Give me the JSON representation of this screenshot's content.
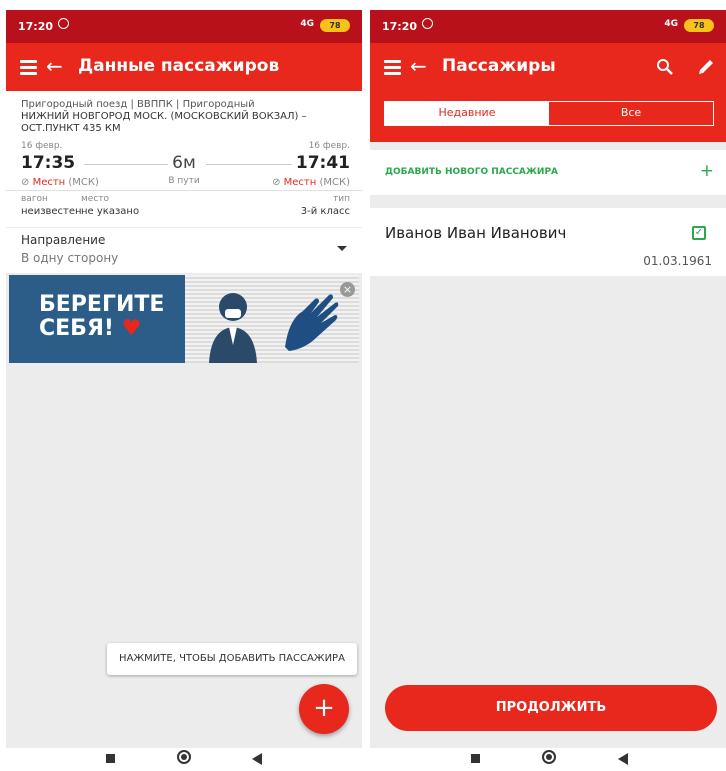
{
  "status_bar": {
    "time": "17:20",
    "network": "4G",
    "battery": "78"
  },
  "left": {
    "title": "Данные пассажиров",
    "train": {
      "type_line": "Пригородный поезд | ВВППК | Пригородный",
      "route_line1": "НИЖНИЙ НОВГОРОД МОСК. (МОСКОВСКИЙ ВОКЗАЛ) –",
      "route_line2": "ОСТ.ПУНКТ 435 КМ",
      "dep_date": "16 февр.",
      "dep_time": "17:35",
      "dep_tz_prefix": "Местн",
      "dep_tz": "(МСК)",
      "arr_date": "16 февр.",
      "arr_time": "17:41",
      "arr_tz_prefix": "Местн",
      "arr_tz": "(МСК)",
      "duration": "6м",
      "duration_label": "В пути",
      "car_label": "вагон",
      "car_value": "неизвестен",
      "seat_label": "место",
      "seat_value": "не указано",
      "type_label": "тип",
      "type_value": "3-й класс"
    },
    "direction_label": "Направление",
    "direction_value": "В одну сторону",
    "banner_line1": "БЕРЕГИТЕ",
    "banner_line2": "СЕБЯ!",
    "hint": "НАЖМИТЕ, ЧТОБЫ ДОБАВИТЬ ПАССАЖИРА",
    "fab_label": "+"
  },
  "right": {
    "title": "Пассажиры",
    "tabs": [
      {
        "label": "Недавние"
      },
      {
        "label": "Все"
      }
    ],
    "add_label": "ДОБАВИТЬ НОВОГО ПАССАЖИРА",
    "add_plus": "+",
    "passenger": {
      "name": "Иванов Иван Иванович",
      "dob": "01.03.1961"
    },
    "continue_label": "ПРОДОЛЖИТЬ"
  }
}
